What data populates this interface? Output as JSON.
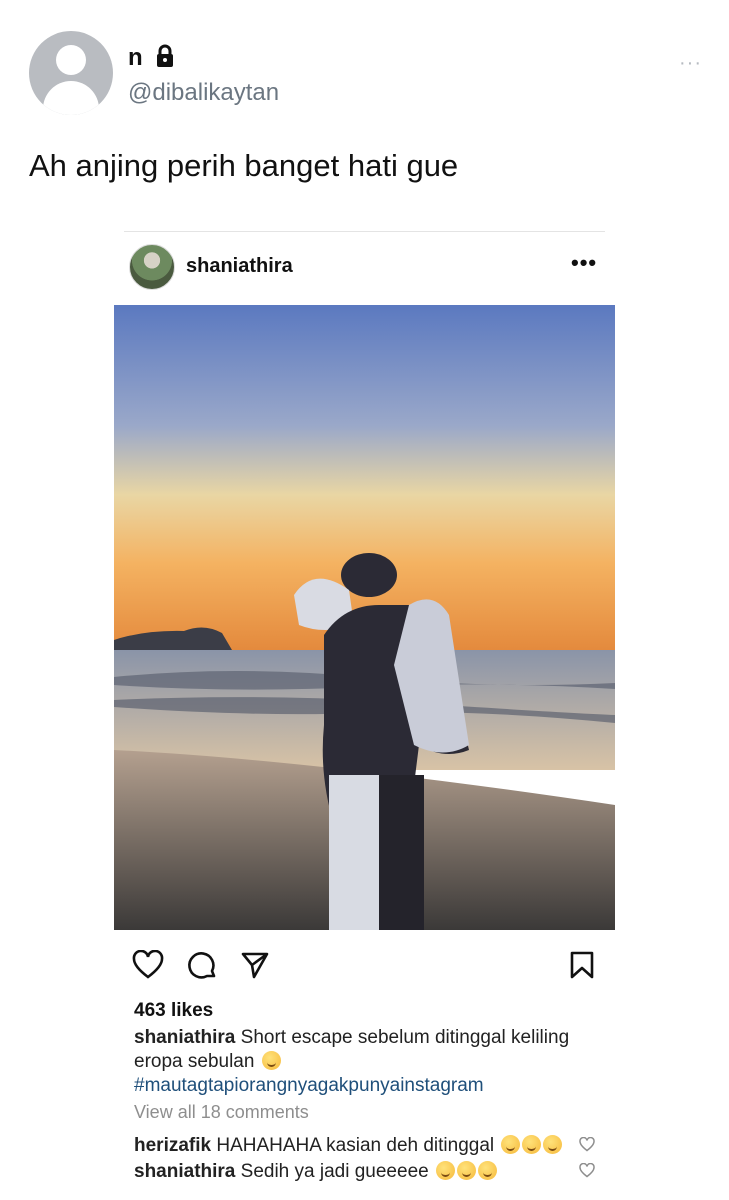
{
  "tweet": {
    "display_name": "n",
    "handle": "@dibalikaytan",
    "more_icon": "···",
    "text": "Ah anjing perih banget hati gue"
  },
  "post": {
    "username": "shaniathira",
    "more_icon": "•••",
    "likes": "463 likes",
    "caption_user": "shaniathira",
    "caption_line1": "Short escape sebelum ditinggal keliling",
    "caption_line2": "eropa sebulan",
    "hashtag": "#mautagtapiorangnyagakpunyainstagram",
    "view_all": "View all 18 comments",
    "comments": [
      {
        "user": "herizafik",
        "text": "HAHAHAHA kasian deh ditinggal"
      },
      {
        "user": "shaniathira",
        "text": "Sedih ya jadi gueeeee"
      }
    ]
  },
  "colors": {
    "handle": "#6b7681",
    "hashtag": "#1f4f7a",
    "muted": "#8e8e8e"
  }
}
